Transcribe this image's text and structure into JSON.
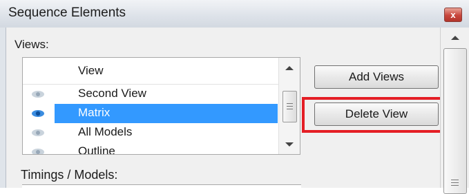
{
  "window": {
    "title": "Sequence Elements",
    "close_glyph": "x"
  },
  "views": {
    "label": "Views:",
    "column_header": "View",
    "rows": [
      {
        "label": "Second View",
        "icon": "eye-icon",
        "selected": false
      },
      {
        "label": "Matrix",
        "icon": "eye-icon",
        "selected": true
      },
      {
        "label": "All Models",
        "icon": "eye-icon",
        "selected": false
      },
      {
        "label": "Outline",
        "icon": "eye-icon",
        "selected": false
      }
    ]
  },
  "buttons": {
    "add_views": "Add Views",
    "delete_view": "Delete View"
  },
  "timings": {
    "label": "Timings / Models:"
  },
  "colors": {
    "selection": "#3399ff",
    "highlight_border": "#e41e25",
    "close_button": "#c8463c"
  }
}
